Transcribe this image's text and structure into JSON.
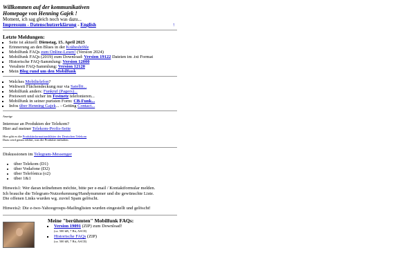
{
  "header": {
    "line1": "Willkommen auf der kommunikativen",
    "line2": "Homepage von Henning Gajek !",
    "line3": "Moment, ich sag gleich noch was dazu...",
    "impressum_link": "Impressum - Datenschutzerklärung",
    "sep": " - ",
    "english_link": "English",
    "up_arrow": "↑"
  },
  "news": {
    "title": "Letzte Meldungen:",
    "items": [
      {
        "pre": "Seite ist aktuell: ",
        "bold": "Dienstag, 15. April 2025"
      },
      {
        "pre": "Erinnerung an den Blues in der ",
        "link": "Kräheshöhle"
      },
      {
        "pre": "Mobilfunk FAQs ",
        "link": "zum Online-Lesen!",
        "post": " (Version 2024)"
      },
      {
        "pre": "Mobilfunk FAQs (2019) zum Download: ",
        "link": "Version 19122",
        "post": " Dateien im .txt Format"
      },
      {
        "pre": "Historische FAQ-Sammlung: ",
        "link": "Version 12000"
      },
      {
        "pre": "Veraltete FAQ-Sammlung: ",
        "link": "Version 12120"
      },
      {
        "pre": "Mein ",
        "link": "Blog rund um den Mobilfunk"
      }
    ]
  },
  "topics": {
    "items": [
      {
        "pre": "Welches ",
        "link": "Mobiltelefon",
        "post": "?"
      },
      {
        "pre": "Weltweit Flächendeckung nur via ",
        "link": "Satellit..."
      },
      {
        "pre": "Mobilfunk anders: ",
        "link": "Funkruf (Pagers)..."
      },
      {
        "pre": "Preiswert und sicher im ",
        "link": "Festnetz",
        "post": " telefonieren..."
      },
      {
        "pre": "Mobilfunk in seiner puristen Form: ",
        "link": "CB-Funk..."
      },
      {
        "pre": "Infos ",
        "link": "über Henning Gajek",
        "post": "... - Getting ",
        "link2": "Contact..."
      }
    ]
  },
  "ad": {
    "label": "Anzeige",
    "line1": "Interesse an Produkten der Telekom?",
    "line2_pre": "Hier auf meiner ",
    "line2_link": "Telekom-Profis-Seite",
    "small1_pre": "Hier gibt es die ",
    "small1_link": "Produktinformationsblätter der Deutschen Telekom",
    "small2": "Dazu wird genau erklärt, was die Produkte enthalten."
  },
  "telegram": {
    "intro_pre": "Diskussionen im ",
    "intro_link": "Telegram-Messenger",
    "items": [
      "über Telekom (D1)",
      "über Vodafone (D2)",
      "über Telefónica (o2)",
      "über 1&1"
    ],
    "hint1_a": "Hinweis1: Wer daran teilnehmen möchte, bitte per e-mail / Kontaktformular melden.",
    "hint1_b": "Ich brauche die Telegram-Nutzerkennung/Handynummer und die gewünschte Liste.",
    "hint1_c": "Die offenen Links wurden wg. zuviel Spam gelöscht.",
    "hint2": "Hinweis2: Die e-two-Yahoogroups-Mailinglisten wurden eingestellt und gelöscht!"
  },
  "faq": {
    "title": "Meine \"berühmten\" Mobilfunk FAQs:",
    "items": [
      {
        "link": "Version 19091",
        "post": " (ZIP) zum Download!"
      },
      {
        "small": "(ca. 500 kB, 7 Bit, ASCII)"
      },
      {
        "link": "Historische FAQs",
        "post": " (ZIP)"
      },
      {
        "small": "(ca. 500 kB, 7 Bit, ASCII)"
      }
    ]
  }
}
